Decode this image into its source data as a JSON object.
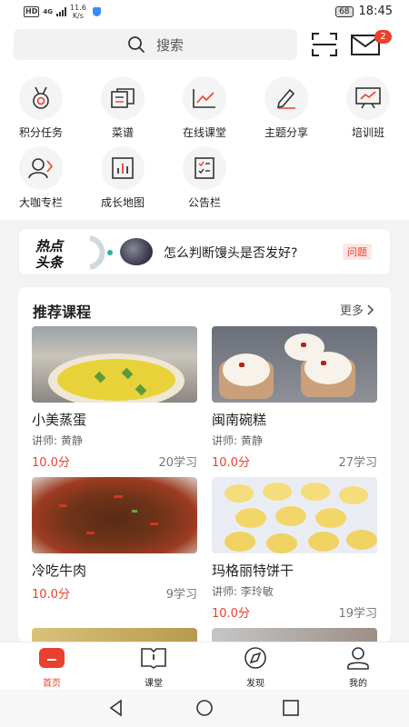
{
  "status": {
    "net": "HD",
    "gen": "4G",
    "speed_top": "11.6",
    "speed_bottom": "K/s",
    "battery": "68",
    "time": "18:45"
  },
  "top": {
    "search_placeholder": "搜索",
    "badge": "2"
  },
  "menu": [
    {
      "label": "积分任务",
      "icon": "medal-icon"
    },
    {
      "label": "菜谱",
      "icon": "book-icon"
    },
    {
      "label": "在线课堂",
      "icon": "chart-icon"
    },
    {
      "label": "主题分享",
      "icon": "pen-icon"
    },
    {
      "label": "培训班",
      "icon": "board-icon"
    },
    {
      "label": "大咖专栏",
      "icon": "expert-icon"
    },
    {
      "label": "成长地图",
      "icon": "bar-chart-icon"
    },
    {
      "label": "公告栏",
      "icon": "notice-icon"
    }
  ],
  "hot": {
    "logo_line1": "热点",
    "logo_line2": "头条",
    "question": "怎么判断馒头是否发好?",
    "tag": "问题"
  },
  "recommend": {
    "title": "推荐课程",
    "more": "更多",
    "courses": [
      {
        "name": "小美蒸蛋",
        "lecturer": "讲师: 黄静",
        "score": "10.0分",
        "learners": "20学习"
      },
      {
        "name": "闽南碗糕",
        "lecturer": "讲师: 黄静",
        "score": "10.0分",
        "learners": "27学习"
      },
      {
        "name": "冷吃牛肉",
        "lecturer": "",
        "score": "10.0分",
        "learners": "9学习"
      },
      {
        "name": "玛格丽特饼干",
        "lecturer": "讲师: 李玲敏",
        "score": "10.0分",
        "learners": "19学习"
      }
    ]
  },
  "tabs": [
    {
      "label": "首页",
      "active": true
    },
    {
      "label": "课堂",
      "active": false
    },
    {
      "label": "发现",
      "active": false
    },
    {
      "label": "我的",
      "active": false
    }
  ],
  "colors": {
    "accent": "#e8412e",
    "background": "#f3f3f3"
  }
}
